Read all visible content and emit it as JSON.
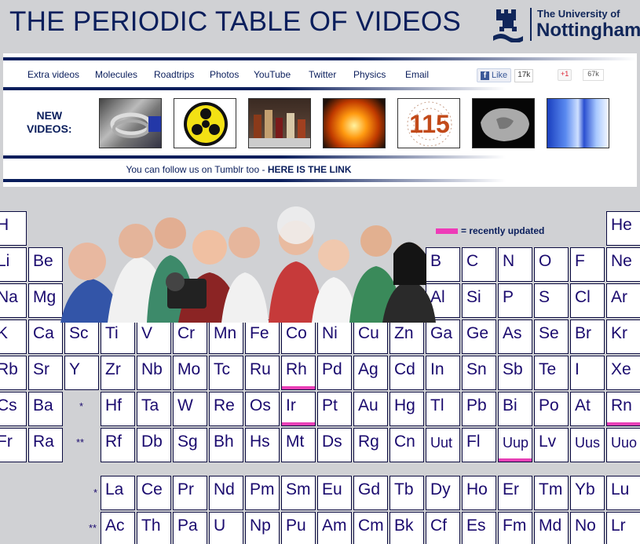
{
  "header": {
    "title": "THE PERIODIC TABLE OF VIDEOS",
    "university_line1": "The University of",
    "university_line2": "Nottingham"
  },
  "nav": {
    "items": [
      "Extra videos",
      "Molecules",
      "Roadtrips",
      "Photos",
      "YouTube",
      "Twitter",
      "Physics",
      "Email"
    ]
  },
  "social": {
    "fb_like": "Like",
    "fb_count": "17k",
    "gplus": "+1",
    "gplus_count": "67k"
  },
  "new_videos": {
    "label_line1": "NEW",
    "label_line2": "VIDEOS:",
    "thumbs": [
      "metal-coil",
      "biohazard-symbol",
      "chemical-bottles",
      "orange-flames",
      "element-115",
      "grey-rock",
      "blue-tubes"
    ],
    "thumb_115_text": "115"
  },
  "tumblr": {
    "text": "You can follow us on Tumblr too - ",
    "link": "HERE IS THE LINK"
  },
  "legend": {
    "text": "= recently updated",
    "color": "#ee3bb8"
  },
  "table": {
    "markers": {
      "lanthanide": "*",
      "actinide": "**"
    },
    "elements": [
      "H",
      "He",
      "Li",
      "Be",
      "B",
      "C",
      "N",
      "O",
      "F",
      "Ne",
      "Na",
      "Mg",
      "Al",
      "Si",
      "P",
      "S",
      "Cl",
      "Ar",
      "K",
      "Ca",
      "Sc",
      "Ti",
      "V",
      "Cr",
      "Mn",
      "Fe",
      "Co",
      "Ni",
      "Cu",
      "Zn",
      "Ga",
      "Ge",
      "As",
      "Se",
      "Br",
      "Kr",
      "Rb",
      "Sr",
      "Y",
      "Zr",
      "Nb",
      "Mo",
      "Tc",
      "Ru",
      "Rh",
      "Pd",
      "Ag",
      "Cd",
      "In",
      "Sn",
      "Sb",
      "Te",
      "I",
      "Xe",
      "Cs",
      "Ba",
      "Hf",
      "Ta",
      "W",
      "Re",
      "Os",
      "Ir",
      "Pt",
      "Au",
      "Hg",
      "Tl",
      "Pb",
      "Bi",
      "Po",
      "At",
      "Rn",
      "Fr",
      "Ra",
      "Rf",
      "Db",
      "Sg",
      "Bh",
      "Hs",
      "Mt",
      "Ds",
      "Rg",
      "Cn",
      "Uut",
      "Fl",
      "Uup",
      "Lv",
      "Uus",
      "Uuo",
      "La",
      "Ce",
      "Pr",
      "Nd",
      "Pm",
      "Sm",
      "Eu",
      "Gd",
      "Tb",
      "Dy",
      "Ho",
      "Er",
      "Tm",
      "Yb",
      "Lu",
      "Ac",
      "Th",
      "Pa",
      "U",
      "Np",
      "Pu",
      "Am",
      "Cm",
      "Bk",
      "Cf",
      "Es",
      "Fm",
      "Md",
      "No",
      "Lr"
    ],
    "recently_updated": [
      "Rh",
      "Ir",
      "Rn",
      "Uup"
    ]
  }
}
